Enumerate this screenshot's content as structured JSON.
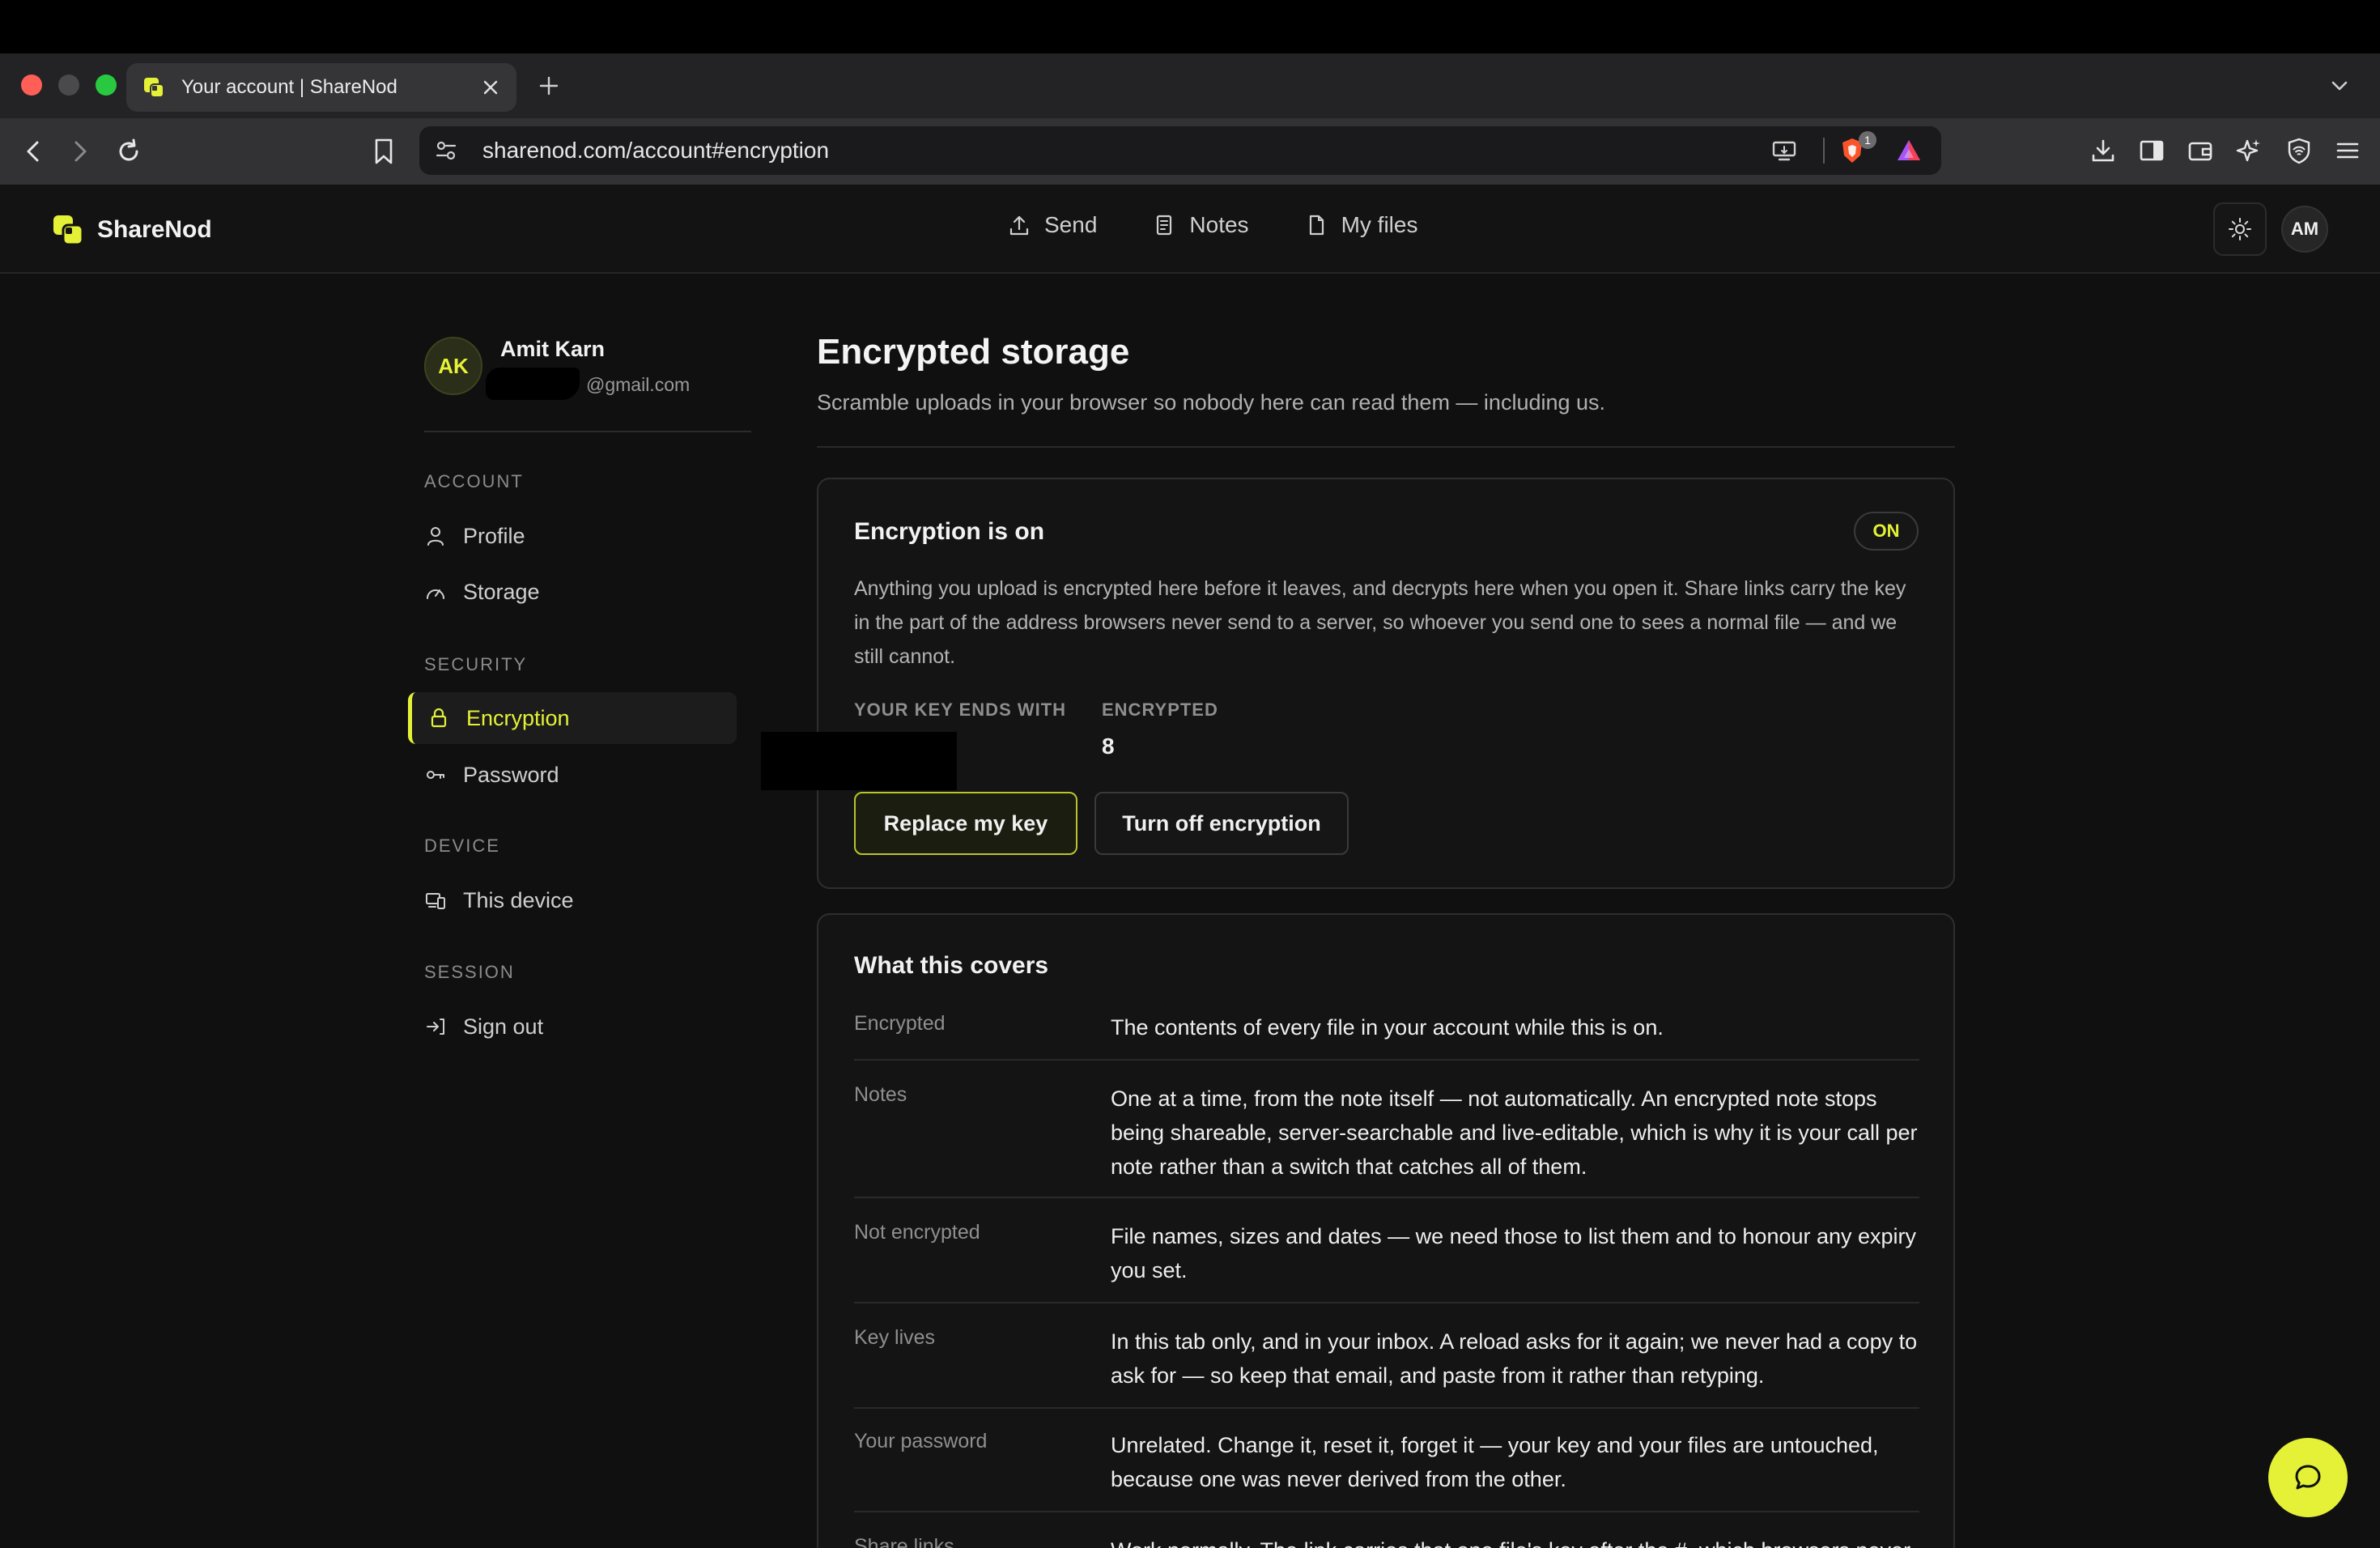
{
  "browser": {
    "tab_title": "Your account | ShareNod",
    "url": "sharenod.com/account#encryption",
    "extension_badge": "1"
  },
  "app": {
    "brand": "ShareNod",
    "nav": [
      {
        "label": "Send",
        "icon": "upload-icon"
      },
      {
        "label": "Notes",
        "icon": "note-icon"
      },
      {
        "label": "My files",
        "icon": "file-icon"
      }
    ],
    "user_initials": "AM"
  },
  "sidebar": {
    "avatar_initials": "AK",
    "user_name": "Amit Karn",
    "user_email": "@gmail.com",
    "sections": [
      {
        "title": "ACCOUNT",
        "items": [
          {
            "label": "Profile",
            "icon": "user-icon"
          },
          {
            "label": "Storage",
            "icon": "gauge-icon"
          }
        ]
      },
      {
        "title": "SECURITY",
        "items": [
          {
            "label": "Encryption",
            "icon": "lock-icon",
            "active": true
          },
          {
            "label": "Password",
            "icon": "key-icon"
          }
        ]
      },
      {
        "title": "DEVICE",
        "items": [
          {
            "label": "This device",
            "icon": "devices-icon"
          }
        ]
      },
      {
        "title": "SESSION",
        "items": [
          {
            "label": "Sign out",
            "icon": "sign-out-icon"
          }
        ]
      }
    ]
  },
  "main": {
    "title": "Encrypted storage",
    "subtitle": "Scramble uploads in your browser so nobody here can read them — including us.",
    "status_card": {
      "title": "Encryption is on",
      "badge": "ON",
      "description": "Anything you upload is encrypted here before it leaves, and decrypts here when you open it. Share links carry the key in the part of the address browsers never send to a server, so whoever you send one to sees a normal file — and we still cannot.",
      "key_label": "YOUR KEY ENDS WITH",
      "encrypted_label": "ENCRYPTED",
      "encrypted_count": "8",
      "replace_button": "Replace my key",
      "turn_off_button": "Turn off encryption"
    },
    "covers_card": {
      "title": "What this covers",
      "rows": [
        {
          "key": "Encrypted",
          "value": "The contents of every file in your account while this is on."
        },
        {
          "key": "Notes",
          "value": "One at a time, from the note itself — not automatically. An encrypted note stops being shareable, server-searchable and live-editable, which is why it is your call per note rather than a switch that catches all of them."
        },
        {
          "key": "Not encrypted",
          "value": "File names, sizes and dates — we need those to list them and to honour any expiry you set."
        },
        {
          "key": "Key lives",
          "value": "In this tab only, and in your inbox. A reload asks for it again; we never had a copy to ask for — so keep that email, and paste from it rather than retyping."
        },
        {
          "key": "Your password",
          "value": "Unrelated. Change it, reset it, forget it — your key and your files are untouched, because one was never derived from the other."
        },
        {
          "key": "Share links",
          "value": "Work normally. The link carries that one file's key after the #, which browsers never"
        }
      ]
    }
  },
  "colors": {
    "accent": "#e4f136",
    "background": "#101010",
    "card": "#141414"
  }
}
